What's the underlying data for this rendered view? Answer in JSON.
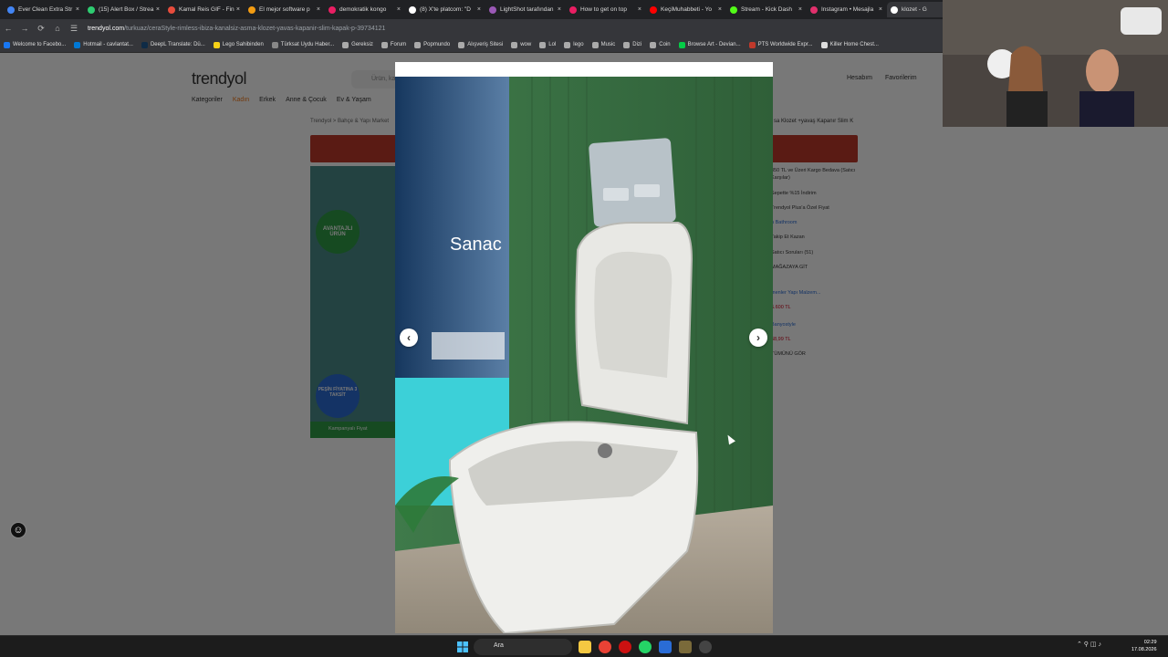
{
  "browser": {
    "tabs": [
      {
        "title": "Ever Clean Extra Str",
        "color": "#4285f4",
        "active": false
      },
      {
        "title": "(15) Alert Box / Strea",
        "color": "#2ecc71",
        "active": false
      },
      {
        "title": "Kamal Reis GIF - Fin",
        "color": "#e74c3c",
        "active": false
      },
      {
        "title": "El mejor software p",
        "color": "#f39c12",
        "active": false
      },
      {
        "title": "demokratik kongo",
        "color": "#e91e63",
        "active": false
      },
      {
        "title": "(8) X'te platcom: \"D",
        "color": "#ffffff",
        "active": false
      },
      {
        "title": "LightShot tarafından",
        "color": "#9b59b6",
        "active": false
      },
      {
        "title": "How to get on top",
        "color": "#e91e63",
        "active": false
      },
      {
        "title": "KeçiMuhabbeti - Yo",
        "color": "#ff0000",
        "active": false
      },
      {
        "title": "Stream - Kick Dash",
        "color": "#53fc18",
        "active": false
      },
      {
        "title": "Instagram • Mesajla",
        "color": "#e1306c",
        "active": false
      },
      {
        "title": "klozet - G",
        "color": "#ffffff",
        "active": true
      }
    ],
    "url_domain": "trendyol.com",
    "url_path": "/turkuaz/ceraStyle-rimless-ibiza-kanalsiz-asma-klozet-yavas-kapanir-slim-kapak-p-39734121",
    "bookmarks": [
      {
        "label": "Welcome to Facebo...",
        "color": "#1877f2"
      },
      {
        "label": "Hotmail - cavlantat...",
        "color": "#0078d4"
      },
      {
        "label": "DeepL Translate: Dü...",
        "color": "#0f2b46"
      },
      {
        "label": "Lego Sahibinden",
        "color": "#f7d117"
      },
      {
        "label": "Türksat Uydu Haber...",
        "color": "#888"
      },
      {
        "label": "Gereksiz",
        "color": "#aaa"
      },
      {
        "label": "Forum",
        "color": "#aaa"
      },
      {
        "label": "Popmundo",
        "color": "#aaa"
      },
      {
        "label": "Alışveriş Sitesi",
        "color": "#aaa"
      },
      {
        "label": "wow",
        "color": "#aaa"
      },
      {
        "label": "Lol",
        "color": "#aaa"
      },
      {
        "label": "lego",
        "color": "#aaa"
      },
      {
        "label": "Music",
        "color": "#aaa"
      },
      {
        "label": "Dizi",
        "color": "#aaa"
      },
      {
        "label": "Coin",
        "color": "#aaa"
      },
      {
        "label": "Browse Art - Devian...",
        "color": "#05cc47"
      },
      {
        "label": "PTS Worldwide Expr...",
        "color": "#c0392b"
      },
      {
        "label": "Killer Home Chest...",
        "color": "#ddd"
      }
    ]
  },
  "site": {
    "logo": "trendyol",
    "search_placeholder": "Ürün, ka",
    "categories": [
      "Kategoriler",
      "Kadın",
      "Erkek",
      "Anne & Çocuk",
      "Ev & Yaşam"
    ],
    "account": [
      "Hesabım",
      "Favorilerim"
    ],
    "breadcrumb": "Trendyol  >  Bahçe & Yapı Market",
    "product_title_fragment": "sa Klozet +yavaş Kapanır Slim K",
    "side": {
      "cargo": "350 TL ve Üzeri Kargo Bedava (Satıcı Karşılar)",
      "discount": "Sepette %15 İndirim",
      "plus": "Trendyol Plus'a Özel Fiyat",
      "store": "n Bathroom",
      "follow": "Takip Et Kazan",
      "questions": "Satıcı Soruları (51)",
      "go_store": "MAĞAZAYA GİT",
      "seller2": "menler Yapı Malzem...",
      "seller2_price": "6.600 TL",
      "seller3": "Banyostyle",
      "seller3_price": "68,99 TL",
      "all": "TÜMÜNÜ GÖR"
    },
    "badge": "AVANTAJLI ÜRÜN",
    "promo": "PEŞİN FİYATINA 3 TAKSİT",
    "campaign": "Kampanyalı Fiyat"
  },
  "modal": {
    "prev_label": "‹",
    "next_label": "›",
    "photo_sign": "Sanac"
  },
  "taskbar": {
    "search_label": "Ara",
    "time": "02:29",
    "date": "17.08.2026"
  }
}
